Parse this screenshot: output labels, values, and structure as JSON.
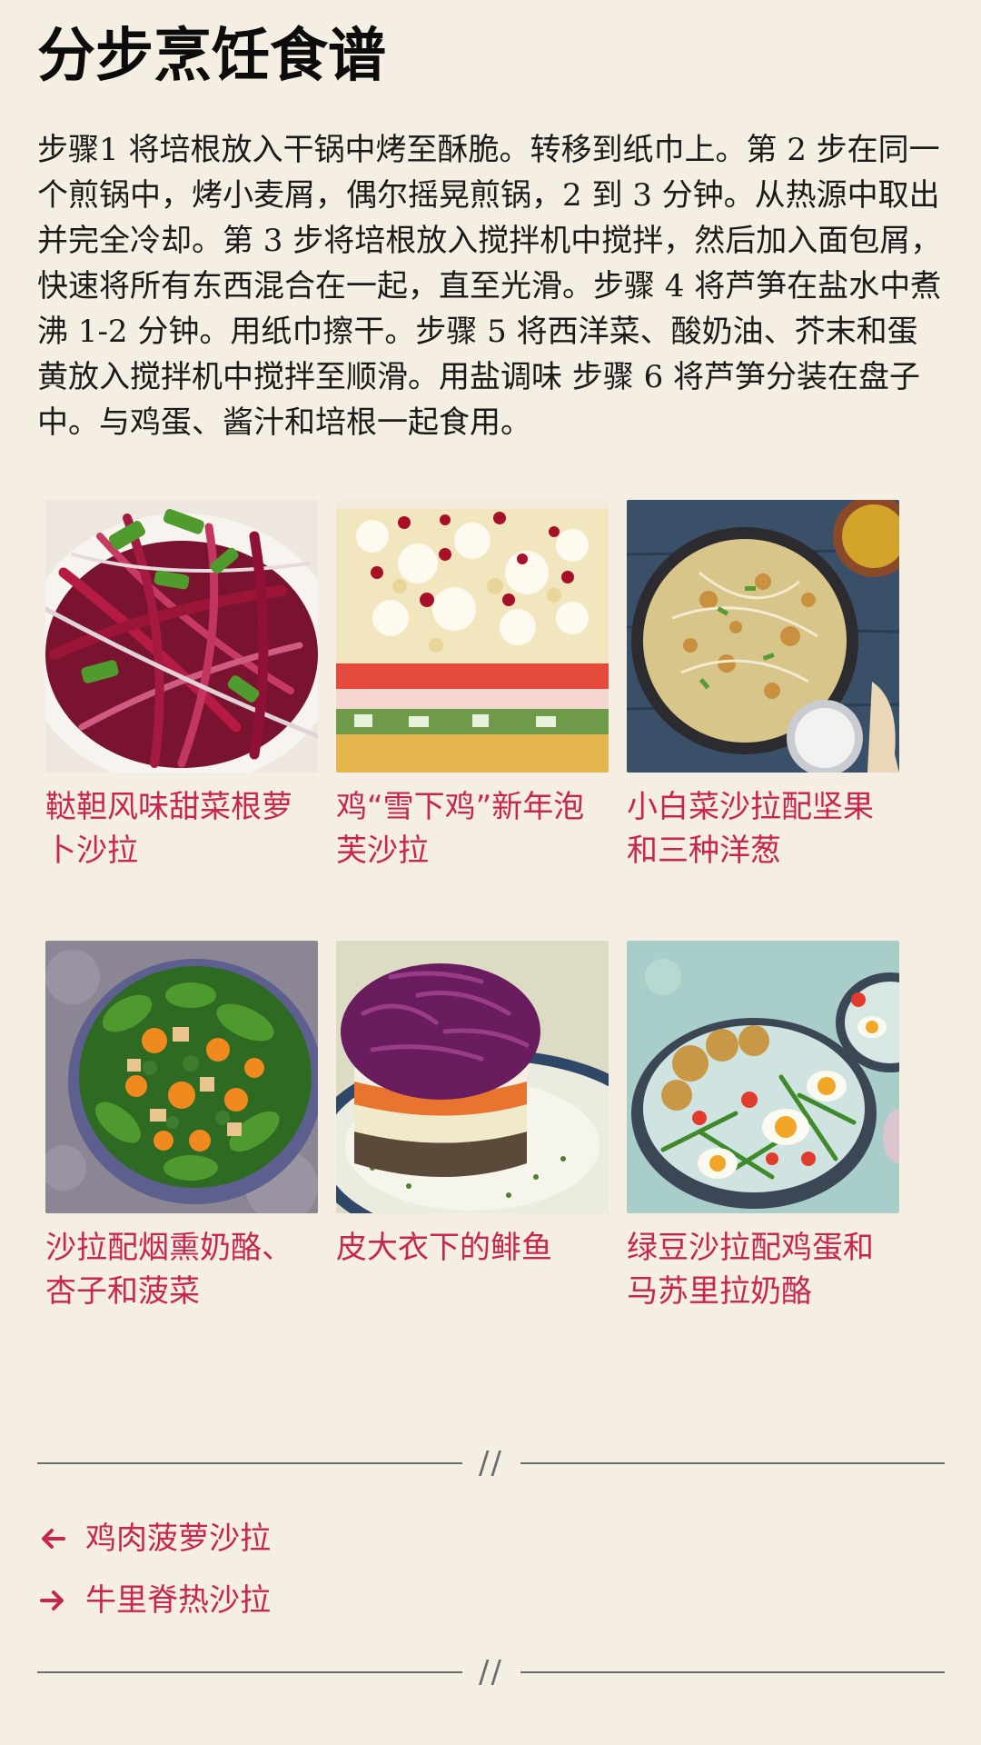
{
  "article": {
    "title": "分步烹饪食谱",
    "steps": "步骤1 将培根放入干锅中烤至酥脆。转移到纸巾上。第 2 步在同一个煎锅中，烤小麦屑，偶尔摇晃煎锅，2 到 3 分钟。从热源中取出并完全冷却。第 3 步将培根放入搅拌机中搅拌，然后加入面包屑，快速将所有东西混合在一起，直至光滑。步骤 4 将芦笋在盐水中煮沸 1-2 分钟。用纸巾擦干。步骤 5 将西洋菜、酸奶油、芥末和蛋黄放入搅拌机中搅拌至顺滑。用盐调味 步骤 6 将芦笋分装在盘子中。与鸡蛋、酱汁和培根一起食用。"
  },
  "related": [
    {
      "title": "鞑靼风味甜菜根萝卜沙拉",
      "image": "beet-radish-salad-photo"
    },
    {
      "title": "鸡“雪下鸡”新年泡芙沙拉",
      "image": "layered-puff-salad-photo"
    },
    {
      "title": "小白菜沙拉配坚果和三种洋葱",
      "image": "cabbage-nut-salad-photo"
    },
    {
      "title": "沙拉配烟熏奶酪、杏子和菠菜",
      "image": "spinach-apricot-salad-photo"
    },
    {
      "title": "皮大衣下的鲱鱼",
      "image": "herring-under-fur-coat-photo"
    },
    {
      "title": "绿豆沙拉配鸡蛋和马苏里拉奶酪",
      "image": "green-bean-egg-salad-photo"
    }
  ],
  "divider_mark": "//",
  "nav": {
    "prev_label": "鸡肉菠萝沙拉",
    "next_label": "牛里脊热沙拉",
    "prev_icon": "arrow-left-icon",
    "next_icon": "arrow-right-icon"
  },
  "colors": {
    "background": "#f5efe3",
    "link": "#c8254f",
    "text": "#1a1a1a",
    "divider": "#6b6b6b"
  }
}
